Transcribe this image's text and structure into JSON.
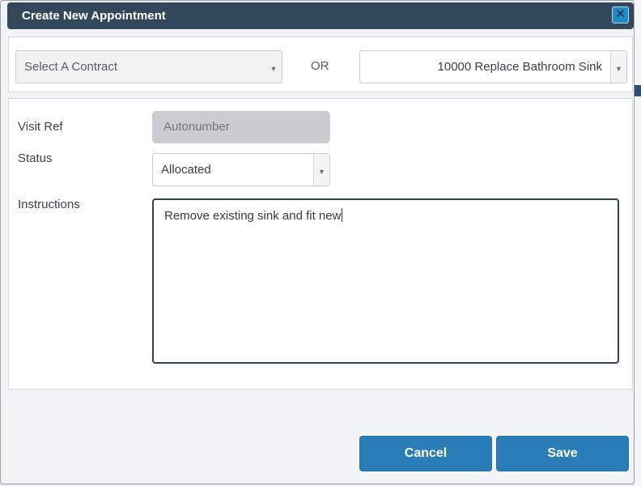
{
  "dialog": {
    "title": "Create New Appointment",
    "close_icon": "close-icon"
  },
  "contract": {
    "placeholder": "Select A Contract",
    "or_label": "OR",
    "job_value": "10000 Replace Bathroom Sink"
  },
  "form": {
    "visit_ref": {
      "label": "Visit Ref",
      "value": "Autonumber"
    },
    "status": {
      "label": "Status",
      "value": "Allocated"
    },
    "instructions": {
      "label": "Instructions",
      "value": "Remove existing sink and fit new"
    }
  },
  "buttons": {
    "cancel": "Cancel",
    "save": "Save"
  },
  "colors": {
    "titlebar": "#33475b",
    "primary_button": "#2a7db7",
    "close_button": "#1e8bc7"
  }
}
